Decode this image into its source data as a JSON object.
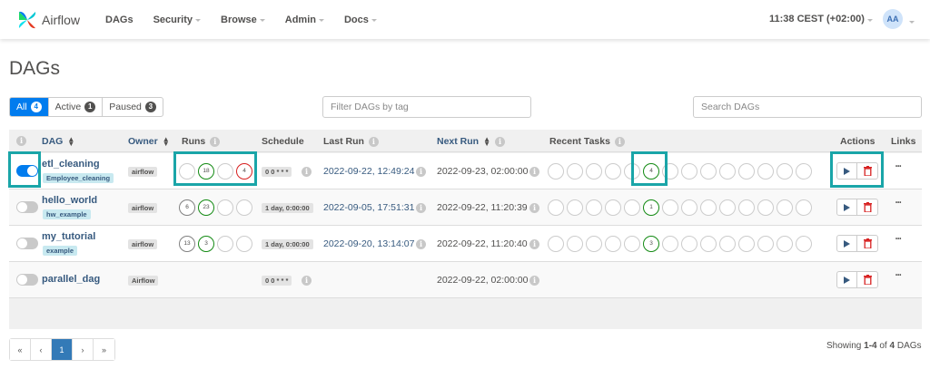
{
  "navbar": {
    "brand": "Airflow",
    "items": [
      {
        "label": "DAGs",
        "caret": false
      },
      {
        "label": "Security",
        "caret": true
      },
      {
        "label": "Browse",
        "caret": true
      },
      {
        "label": "Admin",
        "caret": true
      },
      {
        "label": "Docs",
        "caret": true
      }
    ],
    "time": "11:38 CEST (+02:00)",
    "avatar": "AA"
  },
  "page_title": "DAGs",
  "filters": {
    "all": {
      "label": "All",
      "count": "4"
    },
    "active": {
      "label": "Active",
      "count": "1"
    },
    "paused": {
      "label": "Paused",
      "count": "3"
    }
  },
  "tag_filter_placeholder": "Filter DAGs by tag",
  "search_placeholder": "Search DAGs",
  "table": {
    "headers": {
      "dag": "DAG",
      "owner": "Owner",
      "runs": "Runs",
      "schedule": "Schedule",
      "last_run": "Last Run",
      "next_run": "Next Run",
      "recent_tasks": "Recent Tasks",
      "actions": "Actions",
      "links": "Links"
    },
    "rows": [
      {
        "dag_id": "etl_cleaning",
        "tag": "Employee_cleaning",
        "owner": "airflow",
        "active": true,
        "runs": [
          {
            "v": "",
            "s": ""
          },
          {
            "v": "18",
            "s": "success"
          },
          {
            "v": "",
            "s": ""
          },
          {
            "v": "4",
            "s": "failed"
          }
        ],
        "schedule": "0 0 * * *",
        "last_run": "2022-09-22, 12:49:24",
        "next_run": "2022-09-23, 02:00:00",
        "recent_task_index": 5,
        "recent_task_count": "4"
      },
      {
        "dag_id": "hello_world",
        "tag": "hw_example",
        "owner": "airflow",
        "active": false,
        "runs": [
          {
            "v": "6",
            "s": "queued"
          },
          {
            "v": "23",
            "s": "success"
          },
          {
            "v": "",
            "s": ""
          },
          {
            "v": "",
            "s": ""
          }
        ],
        "schedule": "1 day, 0:00:00",
        "last_run": "2022-09-05, 17:51:31",
        "next_run": "2022-09-22, 11:20:39",
        "recent_task_index": 5,
        "recent_task_count": "1"
      },
      {
        "dag_id": "my_tutorial",
        "tag": "example",
        "owner": "airflow",
        "active": false,
        "runs": [
          {
            "v": "13",
            "s": "queued"
          },
          {
            "v": "3",
            "s": "success"
          },
          {
            "v": "",
            "s": ""
          },
          {
            "v": "",
            "s": ""
          }
        ],
        "schedule": "1 day, 0:00:00",
        "last_run": "2022-09-20, 13:14:07",
        "next_run": "2022-09-22, 11:20:40",
        "recent_task_index": 5,
        "recent_task_count": "3"
      },
      {
        "dag_id": "parallel_dag",
        "tag": "",
        "owner": "Airflow",
        "active": false,
        "runs": [],
        "schedule": "0 0 * * *",
        "last_run": "",
        "next_run": "2022-09-22, 02:00:00",
        "recent_task_index": -1,
        "recent_task_count": ""
      }
    ]
  },
  "pagination": {
    "first": "«",
    "prev": "‹",
    "current": "1",
    "next": "›",
    "last": "»"
  },
  "showing": {
    "prefix": "Showing",
    "range": "1-4",
    "of": "of",
    "total": "4",
    "suffix": "DAGs"
  },
  "colors": {
    "primary": "#017cee",
    "link": "#375a7f",
    "success": "#138a13",
    "failed": "#d72020",
    "highlight": "#1aa5a8"
  }
}
